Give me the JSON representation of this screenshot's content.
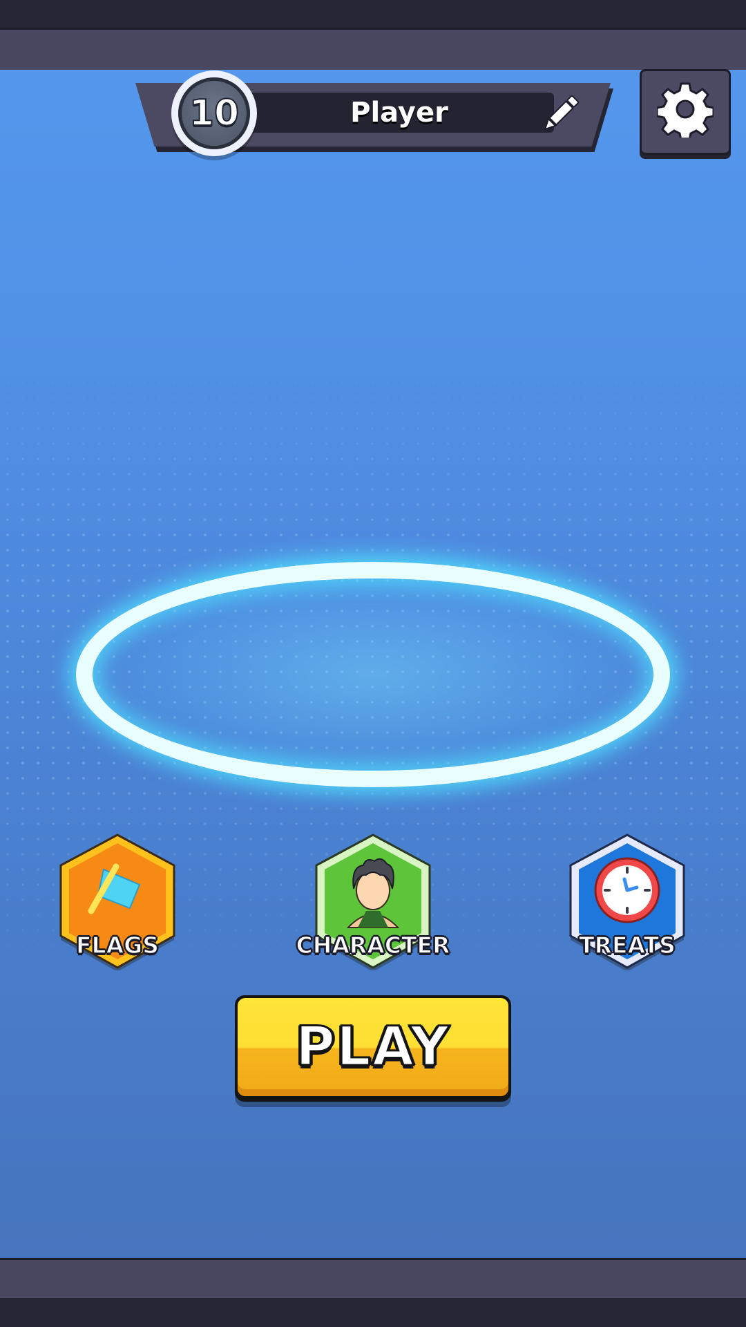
{
  "header": {
    "level": "10",
    "player_name": "Player",
    "edit_icon": "pencil-icon",
    "settings_icon": "gear-icon"
  },
  "features": [
    {
      "label": "FLAGS",
      "icon": "flag-icon",
      "color": "#f7a21a"
    },
    {
      "label": "CHARACTER",
      "icon": "character-icon",
      "color": "#5ec43a"
    },
    {
      "label": "TREATS",
      "icon": "clock-icon",
      "color": "#1e78dc"
    }
  ],
  "play": {
    "label": "PLAY",
    "color": "#ffdf33"
  },
  "colors": {
    "background": "#4f8de2",
    "ring": "#e9ffff",
    "bars": "#4a4860"
  }
}
